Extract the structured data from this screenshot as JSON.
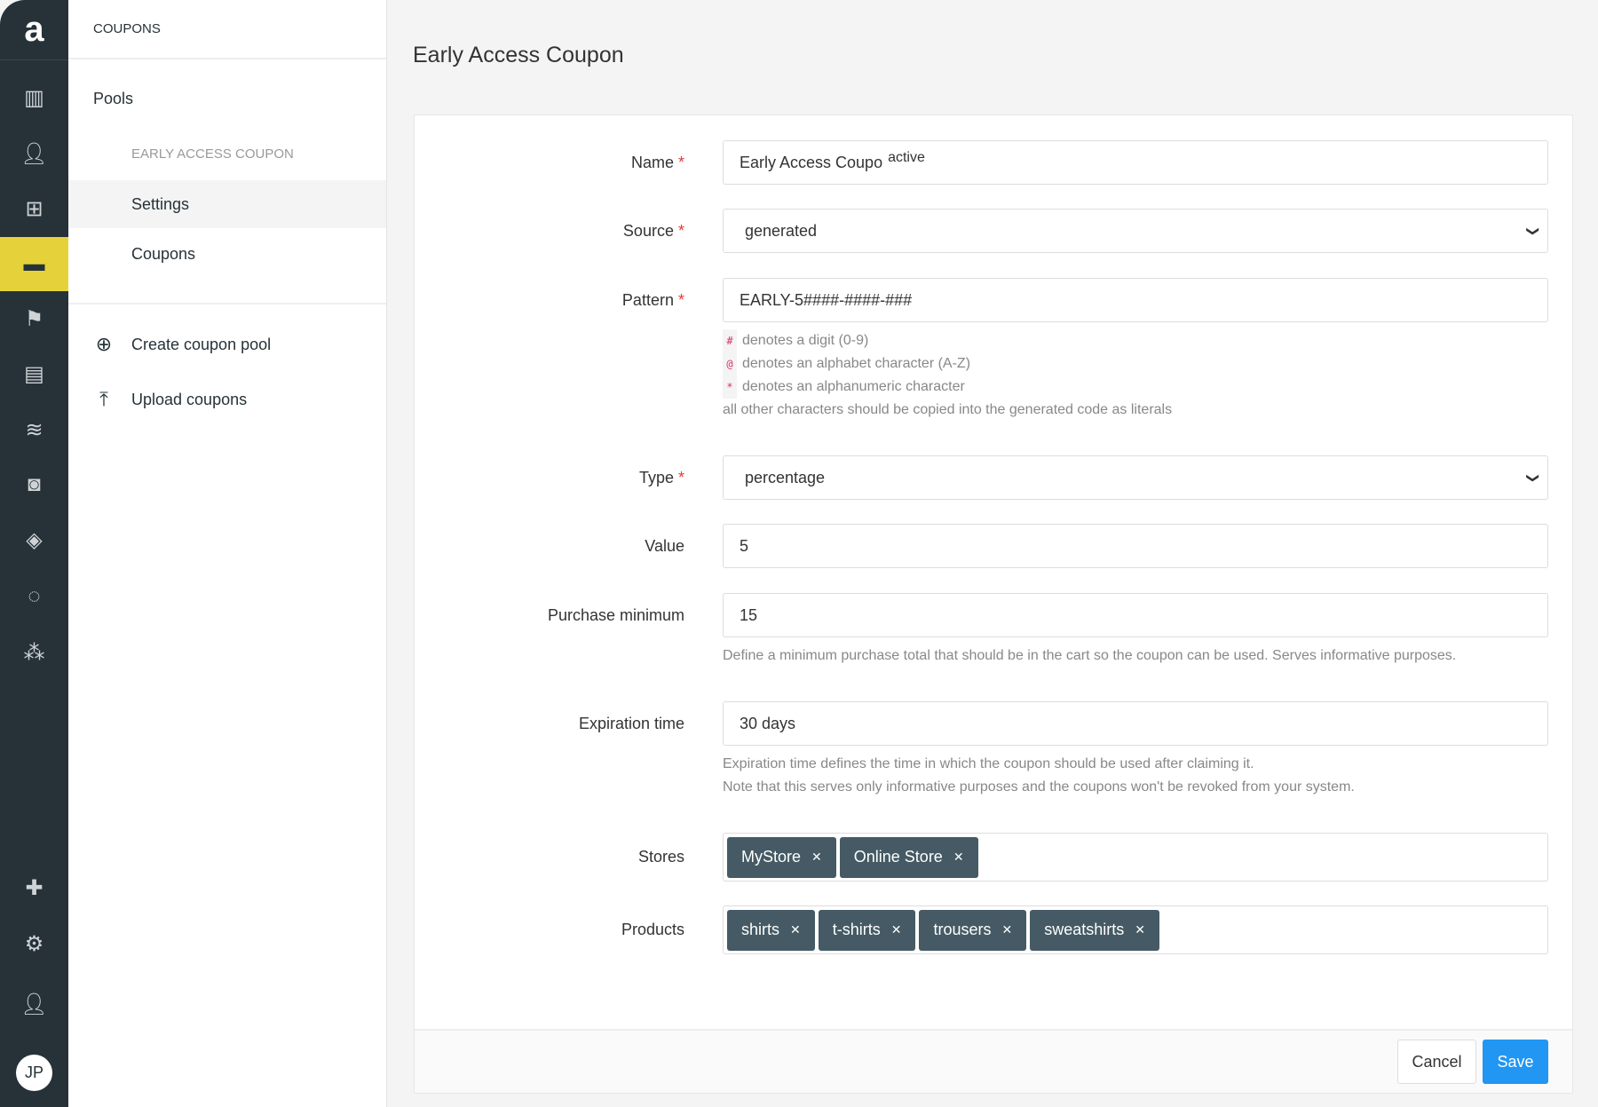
{
  "rail": {
    "logo": "a",
    "icons": [
      "analytics-icon",
      "customers-icon",
      "gift-icon",
      "wallet-icon",
      "flag-icon",
      "message-icon",
      "waves-icon",
      "instagram-icon",
      "tag-icon",
      "chat-icon",
      "stars-icon",
      "puzzle-icon",
      "gear-icon",
      "user-lock-icon"
    ],
    "avatar": "JP",
    "active_color": "#e5d23b"
  },
  "nav": {
    "header": "COUPONS",
    "pools": "Pools",
    "pool_name": "EARLY ACCESS COUPON",
    "settings": "Settings",
    "coupons": "Coupons",
    "create": "Create coupon pool",
    "upload": "Upload coupons"
  },
  "page": {
    "title": "Early Access Coupon"
  },
  "form": {
    "name": {
      "label": "Name",
      "value": "Early Access Coupo",
      "overlay": "active"
    },
    "source": {
      "label": "Source",
      "value": "generated"
    },
    "pattern": {
      "label": "Pattern",
      "value": "EARLY-5####-####-###",
      "hints": [
        {
          "code": "#",
          "text": "denotes a digit (0-9)"
        },
        {
          "code": "@",
          "text": "denotes an alphabet character (A-Z)"
        },
        {
          "code": "*",
          "text": "denotes an alphanumeric character"
        }
      ],
      "note": "all other characters should be copied into the generated code as literals"
    },
    "type": {
      "label": "Type",
      "value": "percentage"
    },
    "value": {
      "label": "Value",
      "value": "5"
    },
    "purchase_minimum": {
      "label": "Purchase minimum",
      "value": "15",
      "hint": "Define a minimum purchase total that should be in the cart so the coupon can be used. Serves informative purposes."
    },
    "expiration": {
      "label": "Expiration time",
      "value": "30 days",
      "hint1": "Expiration time defines the time in which the coupon should be used after claiming it.",
      "hint2": "Note that this serves only informative purposes and the coupons won't be revoked from your system."
    },
    "stores": {
      "label": "Stores",
      "chips": [
        "MyStore",
        "Online Store"
      ]
    },
    "products": {
      "label": "Products",
      "chips": [
        "shirts",
        "t-shirts",
        "trousers",
        "sweatshirts"
      ]
    },
    "required_mark": "*"
  },
  "footer": {
    "cancel": "Cancel",
    "save": "Save",
    "save_color": "#2196f3"
  }
}
